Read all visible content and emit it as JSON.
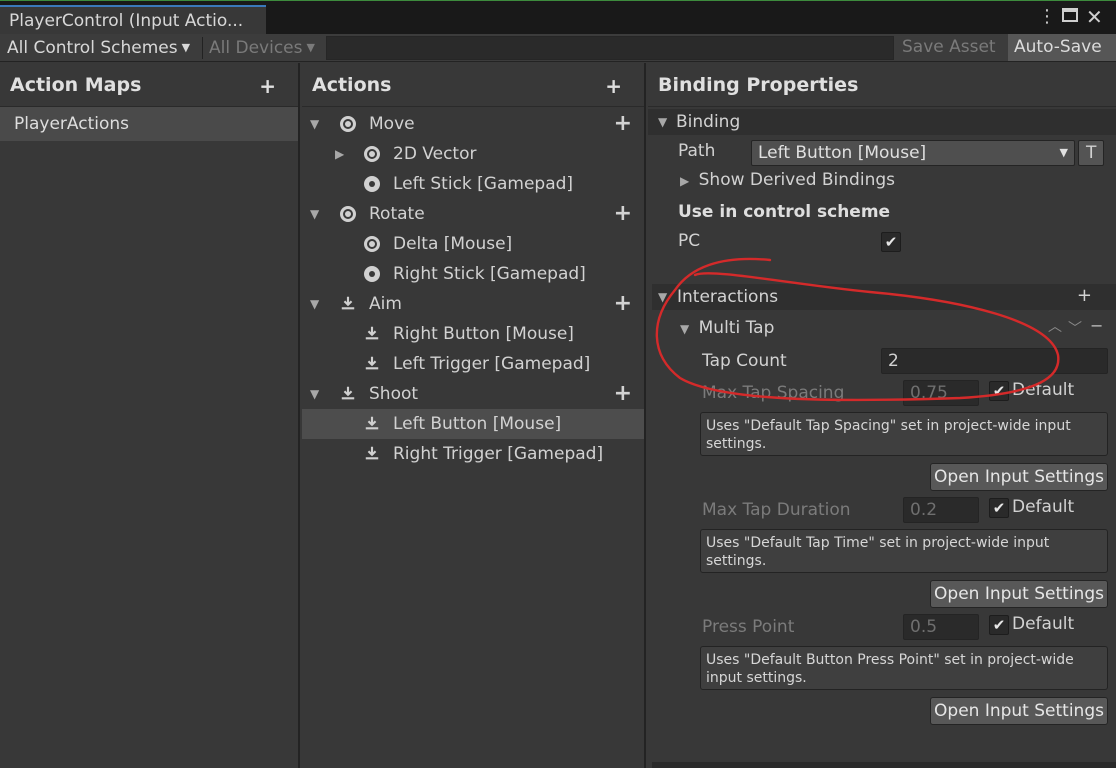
{
  "tab": {
    "title": "PlayerControl (Input Actio..."
  },
  "icons": {
    "menu": "kebab-menu-icon",
    "maximize": "maximize-icon"
  },
  "toolbar": {
    "control_schemes": "All Control Schemes",
    "devices": "All Devices",
    "save_asset": "Save Asset",
    "auto_save": "Auto-Save"
  },
  "action_maps": {
    "title": "Action Maps",
    "add": "+",
    "items": [
      "PlayerActions"
    ]
  },
  "actions": {
    "title": "Actions",
    "add": "+",
    "rows": [
      {
        "label": "Move",
        "kind": "action"
      },
      {
        "label": "2D Vector",
        "kind": "composite"
      },
      {
        "label": "Left Stick [Gamepad]",
        "kind": "binding"
      },
      {
        "label": "Rotate",
        "kind": "action"
      },
      {
        "label": "Delta [Mouse]",
        "kind": "binding"
      },
      {
        "label": "Right Stick [Gamepad]",
        "kind": "binding"
      },
      {
        "label": "Aim",
        "kind": "action"
      },
      {
        "label": "Right Button [Mouse]",
        "kind": "binding"
      },
      {
        "label": "Left Trigger [Gamepad]",
        "kind": "binding"
      },
      {
        "label": "Shoot",
        "kind": "action"
      },
      {
        "label": "Left Button [Mouse]",
        "kind": "binding"
      },
      {
        "label": "Right Trigger [Gamepad]",
        "kind": "binding"
      }
    ]
  },
  "binding_properties": {
    "title": "Binding Properties",
    "binding_section": "Binding",
    "path_label": "Path",
    "path_value": "Left Button [Mouse]",
    "path_t_button": "T",
    "derived_bindings": "Show Derived Bindings",
    "control_scheme_heading": "Use in control scheme",
    "scheme_name": "PC",
    "scheme_checked": true,
    "interactions_section": "Interactions",
    "interactions_add": "+",
    "interaction_name": "Multi Tap",
    "tap_count_label": "Tap Count",
    "tap_count_value": "2",
    "max_tap_spacing_label": "Max Tap Spacing",
    "max_tap_spacing_value": "0.75",
    "max_tap_duration_label": "Max Tap Duration",
    "max_tap_duration_value": "0.2",
    "press_point_label": "Press Point",
    "press_point_value": "0.5",
    "default_label": "Default",
    "help_spacing": "Uses \"Default Tap Spacing\" set in project-wide input settings.",
    "help_time": "Uses \"Default Tap Time\" set in project-wide input settings.",
    "help_press": "Uses \"Default Button Press Point\" set in project-wide input settings.",
    "open_settings": "Open Input Settings"
  },
  "colors": {
    "annotation": "#d42a2a",
    "accent_tab": "#3a79bb"
  }
}
